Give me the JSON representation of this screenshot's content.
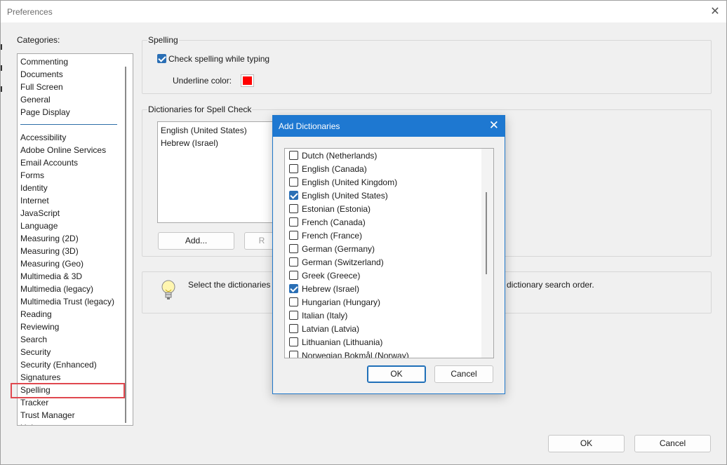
{
  "window": {
    "title": "Preferences",
    "close_glyph": "✕"
  },
  "categories": {
    "label": "Categories:",
    "group1": [
      "Commenting",
      "Documents",
      "Full Screen",
      "General",
      "Page Display"
    ],
    "group2": [
      "Accessibility",
      "Adobe Online Services",
      "Email Accounts",
      "Forms",
      "Identity",
      "Internet",
      "JavaScript",
      "Language",
      "Measuring (2D)",
      "Measuring (3D)",
      "Measuring (Geo)",
      "Multimedia & 3D",
      "Multimedia (legacy)",
      "Multimedia Trust (legacy)",
      "Reading",
      "Reviewing",
      "Search",
      "Security",
      "Security (Enhanced)",
      "Signatures",
      "Spelling",
      "Tracker",
      "Trust Manager",
      "Units"
    ],
    "selected": "Spelling"
  },
  "spelling": {
    "group_title": "Spelling",
    "check_label": "Check spelling while typing",
    "check_checked": true,
    "underline_label": "Underline color:",
    "underline_color": "#ff0000"
  },
  "dictionaries": {
    "group_title": "Dictionaries for Spell Check",
    "items": [
      "English (United States)",
      "Hebrew (Israel)"
    ],
    "add_label": "Add...",
    "remove_label": "R"
  },
  "hint": {
    "text_left": "Select the dictionaries f",
    "text_right": "dictionary search order.",
    "icon": "lightbulb-icon"
  },
  "footer": {
    "ok_label": "OK",
    "cancel_label": "Cancel"
  },
  "modal": {
    "title": "Add Dictionaries",
    "close_glyph": "✕",
    "languages": [
      {
        "label": "Dutch (Netherlands)",
        "checked": false
      },
      {
        "label": "English (Canada)",
        "checked": false
      },
      {
        "label": "English (United Kingdom)",
        "checked": false
      },
      {
        "label": "English (United States)",
        "checked": true
      },
      {
        "label": "Estonian (Estonia)",
        "checked": false
      },
      {
        "label": "French (Canada)",
        "checked": false
      },
      {
        "label": "French (France)",
        "checked": false
      },
      {
        "label": "German (Germany)",
        "checked": false
      },
      {
        "label": "German (Switzerland)",
        "checked": false
      },
      {
        "label": "Greek (Greece)",
        "checked": false
      },
      {
        "label": "Hebrew (Israel)",
        "checked": true
      },
      {
        "label": "Hungarian (Hungary)",
        "checked": false
      },
      {
        "label": "Italian (Italy)",
        "checked": false
      },
      {
        "label": "Latvian (Latvia)",
        "checked": false
      },
      {
        "label": "Lithuanian (Lithuania)",
        "checked": false
      },
      {
        "label": "Norwegian Bokmål (Norway)",
        "checked": false
      }
    ],
    "ok_label": "OK",
    "cancel_label": "Cancel"
  }
}
